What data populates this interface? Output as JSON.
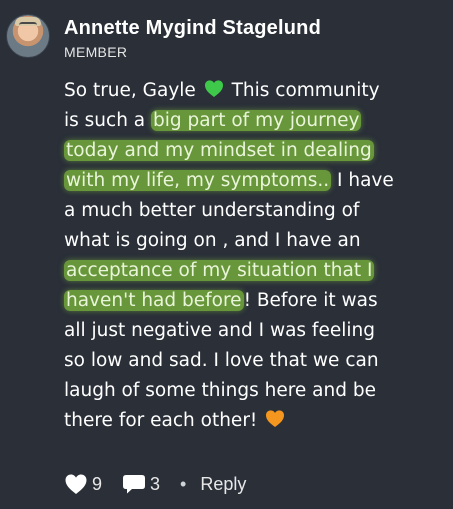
{
  "post": {
    "author": "Annette Mygind Stagelund",
    "role": "MEMBER",
    "lines": [
      {
        "segments": [
          {
            "text": "So true, Gayle "
          },
          {
            "emoji": "green-heart"
          },
          {
            "text": " This community"
          }
        ]
      },
      {
        "segments": [
          {
            "text": "is such a "
          },
          {
            "text": "big part of my journey",
            "highlight": true
          }
        ]
      },
      {
        "segments": [
          {
            "text": "today and my mindset in dealing",
            "highlight": true
          }
        ]
      },
      {
        "segments": [
          {
            "text": "with my life, my symptoms..",
            "highlight": true
          },
          {
            "text": " I have"
          }
        ]
      },
      {
        "segments": [
          {
            "text": "a much better understanding of"
          }
        ]
      },
      {
        "segments": [
          {
            "text": "what is going on , and I have an"
          }
        ]
      },
      {
        "segments": [
          {
            "text": "acceptance of my situation that I",
            "highlight": true
          }
        ]
      },
      {
        "segments": [
          {
            "text": "haven't had before",
            "highlight": true
          },
          {
            "text": "! Before it was"
          }
        ]
      },
      {
        "segments": [
          {
            "text": "all just negative and I was feeling"
          }
        ]
      },
      {
        "segments": [
          {
            "text": "so low and sad. I love that we can"
          }
        ]
      },
      {
        "segments": [
          {
            "text": "laugh of some things here and be"
          }
        ]
      },
      {
        "segments": [
          {
            "text": "there for each other! "
          },
          {
            "emoji": "orange-heart"
          }
        ]
      }
    ]
  },
  "actions": {
    "likes": "9",
    "comments": "3",
    "separator": "•",
    "reply_label": "Reply"
  },
  "colors": {
    "background": "#2a2f38",
    "highlight": "#7ab43c",
    "green_heart": "#3ec94a",
    "orange_heart": "#f5961e"
  }
}
